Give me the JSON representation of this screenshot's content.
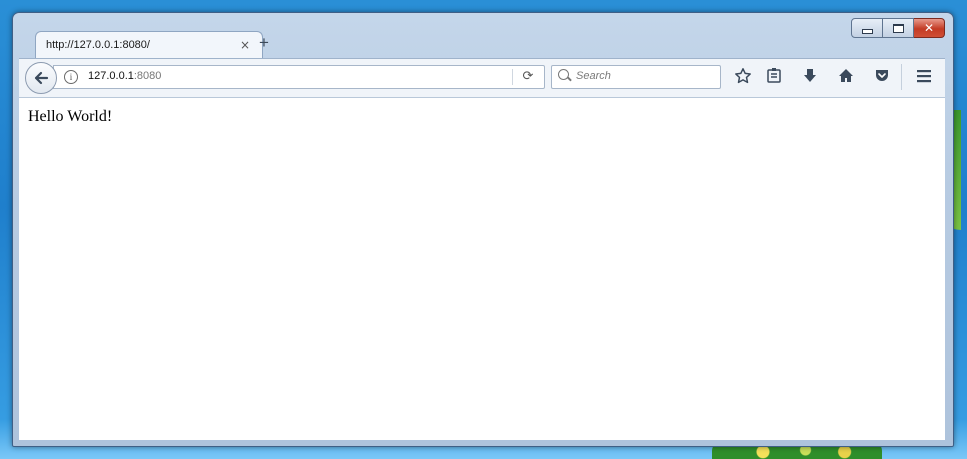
{
  "tab": {
    "title": "http://127.0.0.1:8080/",
    "close_symbol": "×"
  },
  "new_tab": {
    "symbol": "+"
  },
  "urlbar": {
    "host": "127.0.0.1",
    "port": ":8080"
  },
  "search": {
    "placeholder": "Search"
  },
  "page": {
    "text": "Hello World!"
  },
  "icons": {
    "back": "back-arrow-icon",
    "info": "info-icon",
    "reload": "reload-icon",
    "search": "search-icon",
    "bookmark": "bookmark-star-icon",
    "library": "library-icon",
    "downloads": "download-arrow-icon",
    "home": "home-icon",
    "pocket": "pocket-icon",
    "menu": "hamburger-menu-icon"
  },
  "colors": {
    "close_button": "#c33b24",
    "window_frame": "#b7cbe2",
    "desktop": "#1f7fcc"
  }
}
